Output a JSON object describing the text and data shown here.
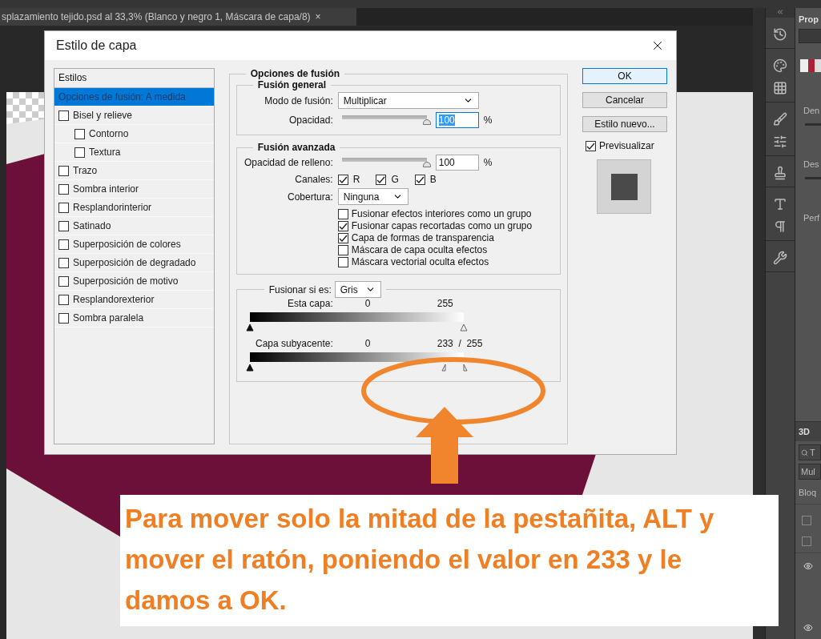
{
  "document_tab": {
    "title": "splazamiento tejido.psd al 33,3% (Blanco y negro 1, Máscara de capa/8)",
    "close": "×"
  },
  "dialog": {
    "title": "Estilo de capa",
    "styles_list": {
      "title": "Estilos",
      "items": [
        {
          "label": "Opciones de fusión: A medida",
          "kind": "header",
          "selected": true
        },
        {
          "label": "Bisel y relieve",
          "kind": "checkbox",
          "checked": false,
          "selected": false,
          "children": [
            {
              "label": "Contorno",
              "kind": "checkbox",
              "checked": false,
              "selected": false
            },
            {
              "label": "Textura",
              "kind": "checkbox",
              "checked": false,
              "selected": false
            }
          ]
        },
        {
          "label": "Trazo",
          "kind": "checkbox",
          "checked": false,
          "selected": false
        },
        {
          "label": "Sombra interior",
          "kind": "checkbox",
          "checked": false,
          "selected": false
        },
        {
          "label": "Resplandorinterior",
          "kind": "checkbox",
          "checked": false,
          "selected": false
        },
        {
          "label": "Satinado",
          "kind": "checkbox",
          "checked": false,
          "selected": false
        },
        {
          "label": "Superposición de colores",
          "kind": "checkbox",
          "checked": false,
          "selected": false
        },
        {
          "label": "Superposición de degradado",
          "kind": "checkbox",
          "checked": false,
          "selected": false
        },
        {
          "label": "Superposición de motivo",
          "kind": "checkbox",
          "checked": false,
          "selected": false
        },
        {
          "label": "Resplandorexterior",
          "kind": "checkbox",
          "checked": false,
          "selected": false
        },
        {
          "label": "Sombra paralela",
          "kind": "checkbox",
          "checked": false,
          "selected": false
        }
      ]
    },
    "blending": {
      "title": "Opciones de fusión",
      "general": {
        "title": "Fusión general",
        "mode_label": "Modo de fusión:",
        "mode": "Multiplicar",
        "opacity": {
          "label": "Opacidad:",
          "level": 1,
          "value": "100",
          "unit": "%",
          "highlighted": true
        }
      },
      "advanced": {
        "title": "Fusión avanzada",
        "fill_opacity": {
          "label": "Opacidad de relleno:",
          "level": 1,
          "value": "100",
          "unit": "%",
          "highlighted": false
        },
        "channels_label": "Canales:",
        "channels": [
          {
            "label": "R",
            "checked": true
          },
          {
            "label": "G",
            "checked": true
          },
          {
            "label": "B",
            "checked": true
          }
        ],
        "knockout_label": "Cobertura:",
        "knockout": "Ninguna",
        "options": [
          {
            "label": "Fusionar efectos interiores como un grupo",
            "checked": false
          },
          {
            "label": "Fusionar capas recortadas como un grupo",
            "checked": true
          },
          {
            "label": "Capa de formas de transparencia",
            "checked": true
          },
          {
            "label": "Máscara de capa oculta efectos",
            "checked": false
          },
          {
            "label": "Máscara vectorial oculta efectos",
            "checked": false
          }
        ]
      },
      "blend_if": {
        "label": "Fusionar si es:",
        "value": "Gris",
        "ranges": [
          {
            "label": "Esta capa:",
            "low": "0",
            "high": "255",
            "handles": [
              {
                "level": 0,
                "kind": "black"
              },
              {
                "level": 1,
                "kind": "white"
              }
            ]
          },
          {
            "label": "Capa subyacente:",
            "low": "0",
            "high": "233  /  255",
            "handles": [
              {
                "level": 0,
                "kind": "black"
              },
              {
                "level": 0.914,
                "kind": "half-left"
              },
              {
                "level": 1,
                "kind": "half-right"
              }
            ]
          }
        ]
      }
    },
    "buttons": [
      {
        "label": "OK",
        "default": true
      },
      {
        "label": "Cancelar",
        "default": false
      },
      {
        "label": "Estilo nuevo...",
        "default": false
      }
    ],
    "preview": {
      "label": "Previsualizar",
      "checked": true
    }
  },
  "annotation": {
    "text": "Para mover solo la mitad de la pestañita, ALT y mover el ratón, poniendo el valor en 233 y le damos a OK."
  },
  "properties_panel": {
    "title": "Prop",
    "labels": [
      "Den",
      "Des"
    ],
    "extra": "Perf"
  },
  "layers_panel": {
    "title": "3D",
    "search_placeholder": "T",
    "filter": "Mul",
    "lock_label": "Bloq",
    "checkboxes": [
      {
        "checked": false
      },
      {
        "checked": false
      }
    ]
  }
}
